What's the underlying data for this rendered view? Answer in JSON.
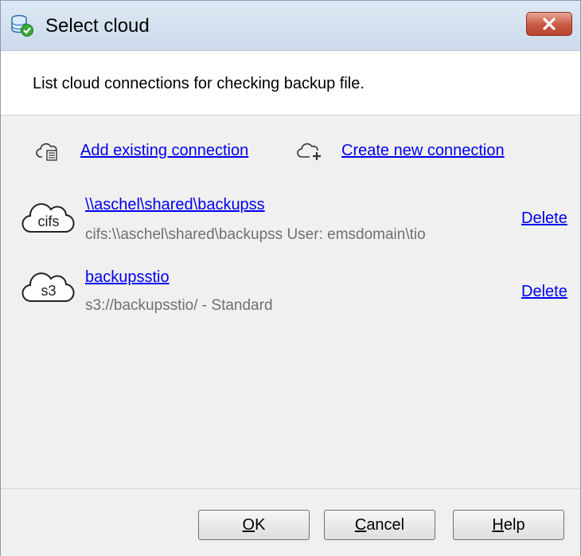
{
  "window": {
    "title": "Select cloud"
  },
  "description": "List cloud connections for checking backup file.",
  "actions": {
    "add_existing": "Add existing connection",
    "create_new": "Create new connection"
  },
  "connections": [
    {
      "badge": "cifs",
      "name": "\\\\aschel\\shared\\backupss",
      "details": "cifs:\\\\aschel\\shared\\backupss User: emsdomain\\tio",
      "delete_label": "Delete"
    },
    {
      "badge": "s3",
      "name": "backupsstio",
      "details": "s3://backupsstio/ - Standard",
      "delete_label": "Delete"
    }
  ],
  "buttons": {
    "ok_mnemonic": "O",
    "ok_rest": "K",
    "cancel_mnemonic": "C",
    "cancel_rest": "ancel",
    "help_mnemonic": "H",
    "help_rest": "elp"
  },
  "icons": {
    "title": "database-check-icon",
    "close": "close-icon",
    "add_existing": "cloud-list-icon",
    "create_new": "cloud-plus-icon",
    "connection": "cloud-badge-icon"
  },
  "colors": {
    "link": "#0000ee",
    "close_button": "#c75a43",
    "subtext": "#707070"
  }
}
